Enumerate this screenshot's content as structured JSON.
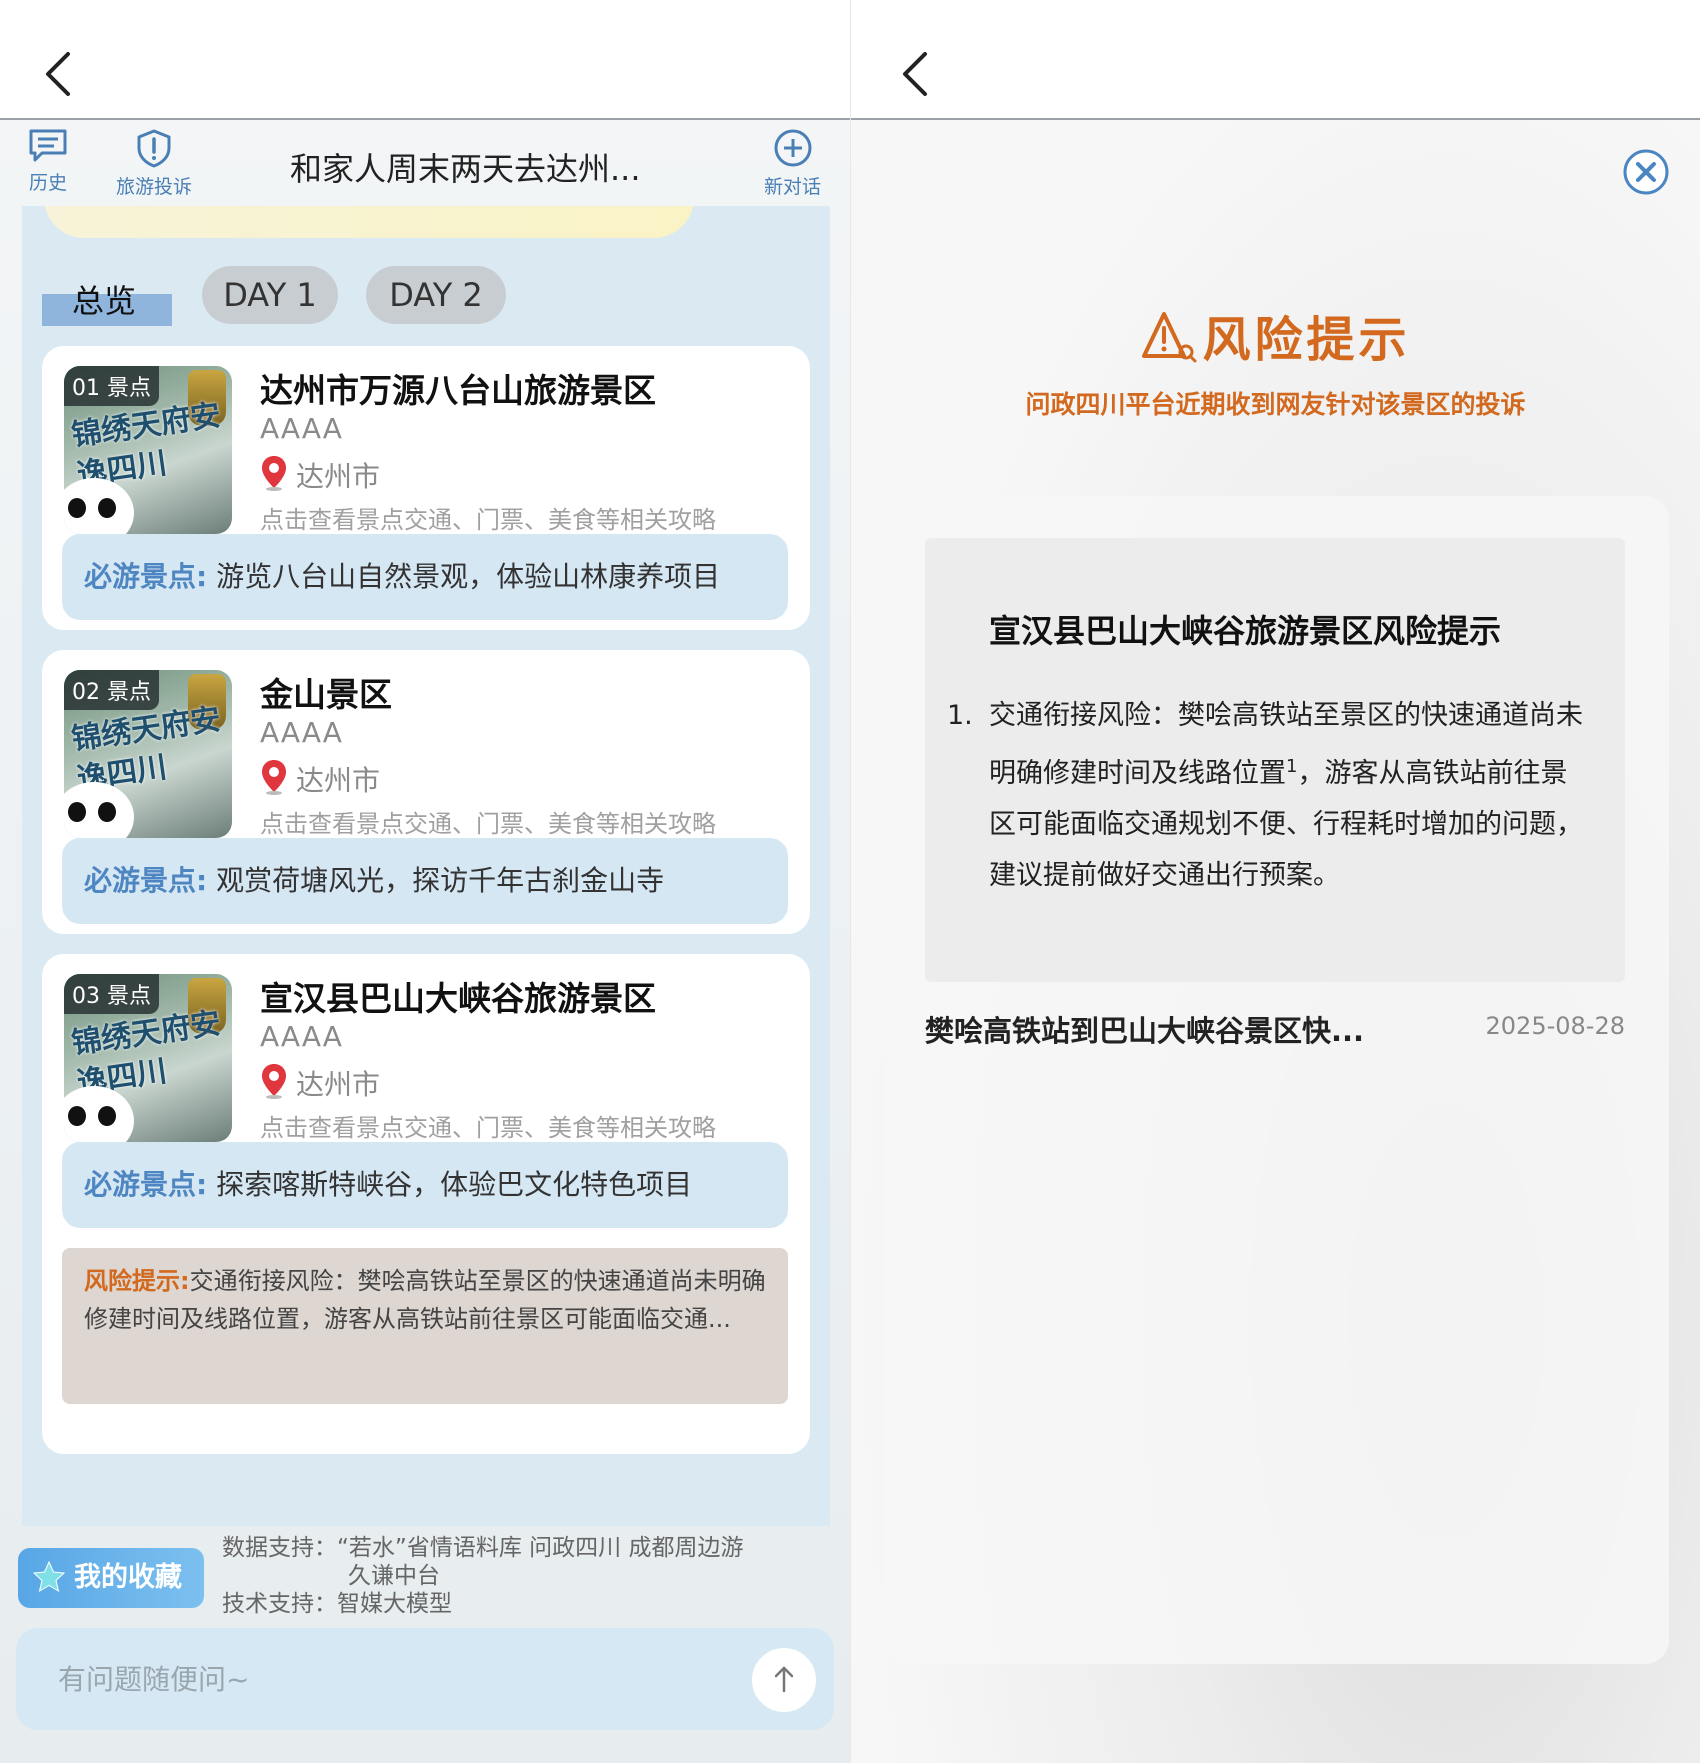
{
  "left": {
    "header": {
      "history_label": "历史",
      "complaint_label": "旅游投诉",
      "title": "和家人周末两天去达州...",
      "new_chat_label": "新对话"
    },
    "tabs": [
      {
        "label": "总览",
        "selected": true
      },
      {
        "label": "DAY 1",
        "selected": false
      },
      {
        "label": "DAY 2",
        "selected": false
      }
    ],
    "cards": [
      {
        "badge": "01 景点",
        "thumb_text": "锦绣天府安逸四川",
        "name": "达州市万源八台山旅游景区",
        "level": "AAAA",
        "location": "达州市",
        "guide": "点击查看景点交通、门票、美食等相关攻略",
        "must_label": "必游景点:",
        "must_text": "游览八台山自然景观，体验山林康养项目"
      },
      {
        "badge": "02 景点",
        "thumb_text": "锦绣天府安逸四川",
        "name": "金山景区",
        "level": "AAAA",
        "location": "达州市",
        "guide": "点击查看景点交通、门票、美食等相关攻略",
        "must_label": "必游景点:",
        "must_text": "观赏荷塘风光，探访千年古刹金山寺"
      },
      {
        "badge": "03 景点",
        "thumb_text": "锦绣天府安逸四川",
        "name": "宣汉县巴山大峡谷旅游景区",
        "level": "AAAA",
        "location": "达州市",
        "guide": "点击查看景点交通、门票、美食等相关攻略",
        "must_label": "必游景点:",
        "must_text": "探索喀斯特峡谷，体验巴文化特色项目",
        "risk_label": "风险提示:",
        "risk_text": "交通衔接风险：樊哙高铁站至景区的快速通道尚未明确修建时间及线路位置，游客从高铁站前往景区可能面临交通..."
      }
    ],
    "favorites_label": "我的收藏",
    "support": {
      "data_line1": "数据支持：“若水”省情语料库 问政四川 成都周边游",
      "data_line2": "久谦中台",
      "tech_line": "技术支持：智媒大模型"
    },
    "input": {
      "placeholder": "有问题随便问~"
    }
  },
  "right": {
    "title": "风险提示",
    "subtitle": "问政四川平台近期收到网友针对该景区的投诉",
    "notice": {
      "title": "宣汉县巴山大峡谷旅游景区风险提示",
      "item_number": "1.",
      "item_text_a": "交通衔接风险：樊哙高铁站至景区的快速通道尚未明确修建时间及线路位置",
      "item_sup": "1",
      "item_text_b": "，游客从高铁站前往景区可能面临交通规划不便、行程耗时增加的问题，建议提前做好交通出行预案。"
    },
    "source": {
      "title": "樊哙高铁站到巴山大峡谷景区快...",
      "date": "2025-08-28"
    }
  },
  "colors": {
    "accent_blue": "#4a7fb5",
    "risk_orange": "#d2691e",
    "must_box_bg": "#d6e7f4",
    "scroll_bg": "#dbe9f3"
  },
  "icons": {
    "back": "chevron-left-icon",
    "history": "chat-list-icon",
    "complaint": "shield-alert-icon",
    "new_chat": "plus-circle-icon",
    "location": "location-pin-icon",
    "favorites": "star-icon",
    "send": "arrow-up-icon",
    "close": "close-circle-icon",
    "warning": "warning-triangle-icon"
  }
}
